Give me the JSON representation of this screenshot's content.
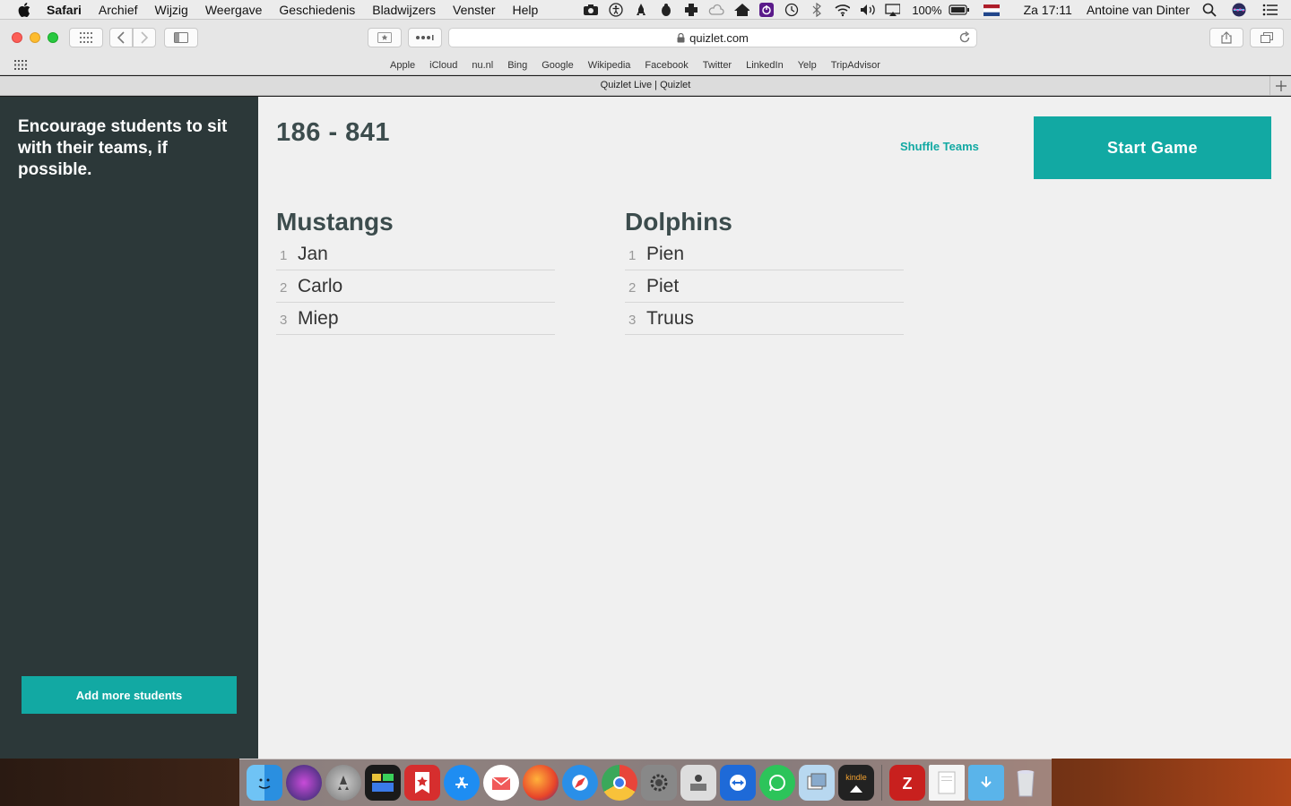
{
  "menubar": {
    "app_name": "Safari",
    "items": [
      "Archief",
      "Wijzig",
      "Weergave",
      "Geschiedenis",
      "Bladwijzers",
      "Venster",
      "Help"
    ],
    "battery": "100%",
    "clock": "Za 17:11",
    "user": "Antoine van Dinter"
  },
  "browser": {
    "url": "quizlet.com",
    "favorites": [
      "Apple",
      "iCloud",
      "nu.nl",
      "Bing",
      "Google",
      "Wikipedia",
      "Facebook",
      "Twitter",
      "LinkedIn",
      "Yelp",
      "TripAdvisor"
    ],
    "tab_title": "Quizlet Live | Quizlet"
  },
  "sidebar": {
    "hint": "Encourage students to sit with their teams, if possible.",
    "add_button": "Add more students"
  },
  "main": {
    "game_code": "186 - 841",
    "shuffle_label": "Shuffle Teams",
    "start_label": "Start Game",
    "teams": [
      {
        "name": "Mustangs",
        "members": [
          {
            "num": "1",
            "name": "Jan"
          },
          {
            "num": "2",
            "name": "Carlo"
          },
          {
            "num": "3",
            "name": "Miep"
          }
        ]
      },
      {
        "name": "Dolphins",
        "members": [
          {
            "num": "1",
            "name": "Pien"
          },
          {
            "num": "2",
            "name": "Piet"
          },
          {
            "num": "3",
            "name": "Truus"
          }
        ]
      }
    ]
  },
  "colors": {
    "accent": "#12a9a3",
    "sidebar": "#2c3839",
    "heading": "#3c4c4d",
    "page_bg": "#f0f0f0"
  },
  "dock": {
    "apps": [
      "finder-icon",
      "siri-icon",
      "launchpad-icon",
      "activity-monitor-icon",
      "wunderlist-icon",
      "app-store-icon",
      "airmail-icon",
      "firefox-icon",
      "safari-icon",
      "chrome-icon",
      "system-preferences-icon",
      "migration-icon",
      "teamviewer-icon",
      "whatsapp-icon",
      "preview-icon",
      "kindle-icon"
    ],
    "extras": [
      "filezilla-icon",
      "html-file-icon",
      "downloads-folder-icon",
      "trash-icon"
    ]
  }
}
